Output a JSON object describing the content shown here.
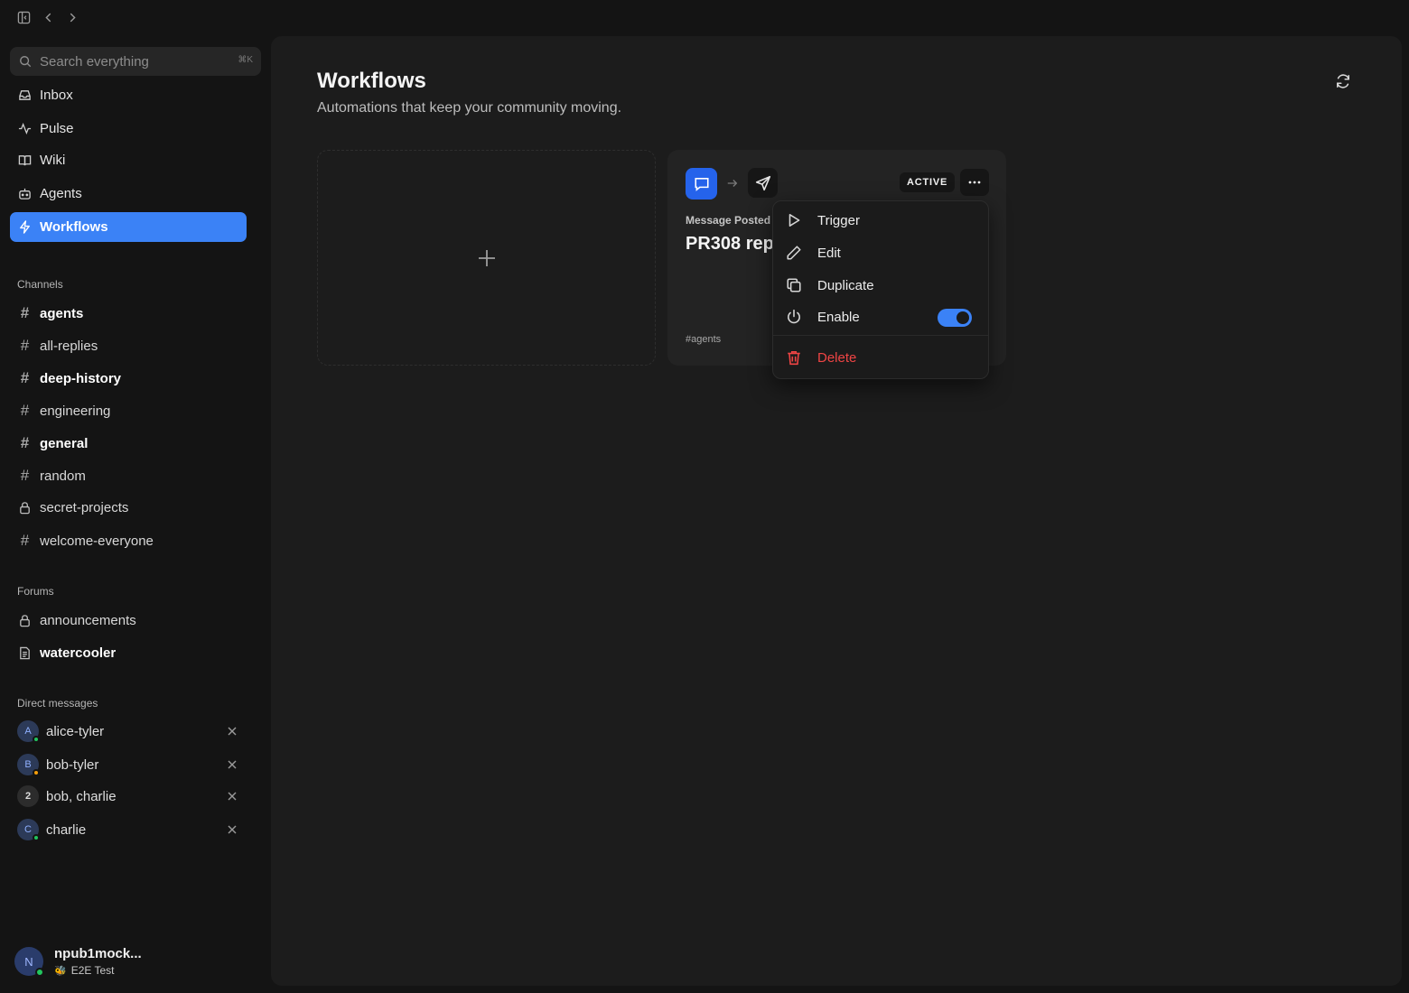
{
  "topbar": {
    "icons": [
      "sidebar-toggle-icon",
      "back-icon",
      "forward-icon"
    ]
  },
  "search": {
    "placeholder": "Search everything",
    "shortcut": "⌘K"
  },
  "nav": {
    "items": [
      {
        "label": "Inbox",
        "icon": "inbox-icon"
      },
      {
        "label": "Pulse",
        "icon": "pulse-icon"
      },
      {
        "label": "Wiki",
        "icon": "book-icon"
      },
      {
        "label": "Agents",
        "icon": "bot-icon"
      },
      {
        "label": "Workflows",
        "icon": "lightning-icon",
        "active": true
      }
    ]
  },
  "channels": {
    "heading": "Channels",
    "items": [
      {
        "label": "agents",
        "bold": true
      },
      {
        "label": "all-replies",
        "bold": false
      },
      {
        "label": "deep-history",
        "bold": true
      },
      {
        "label": "engineering",
        "bold": false
      },
      {
        "label": "general",
        "bold": true
      },
      {
        "label": "random",
        "bold": false
      },
      {
        "label": "secret-projects",
        "bold": false,
        "icon": "lock-icon"
      },
      {
        "label": "welcome-everyone",
        "bold": false
      }
    ]
  },
  "forums": {
    "heading": "Forums",
    "items": [
      {
        "label": "announcements",
        "icon": "lock-icon",
        "bold": false
      },
      {
        "label": "watercooler",
        "icon": "document-icon",
        "bold": true
      }
    ]
  },
  "dms": {
    "heading": "Direct messages",
    "items": [
      {
        "label": "alice-tyler",
        "initial": "A",
        "presence": "online"
      },
      {
        "label": "bob-tyler",
        "initial": "B",
        "presence": "away"
      },
      {
        "label": "bob, charlie",
        "initial": "2",
        "presence": "none"
      },
      {
        "label": "charlie",
        "initial": "C",
        "presence": "online"
      }
    ]
  },
  "user": {
    "initial": "N",
    "name": "npub1mock...",
    "status_emoji": "🐝",
    "status": "E2E Test"
  },
  "page": {
    "title": "Workflows",
    "subtitle": "Automations that keep your community moving."
  },
  "workflow": {
    "badge": "ACTIVE",
    "trigger_label": "Message Posted",
    "name": "PR308 rep",
    "channel": "#agents"
  },
  "menu": {
    "trigger": "Trigger",
    "edit": "Edit",
    "duplicate": "Duplicate",
    "enable": "Enable",
    "enabled": true,
    "delete": "Delete"
  },
  "colors": {
    "accent": "#3b82f6",
    "danger": "#ef4444",
    "online": "#22c55e",
    "away": "#f59e0b"
  }
}
